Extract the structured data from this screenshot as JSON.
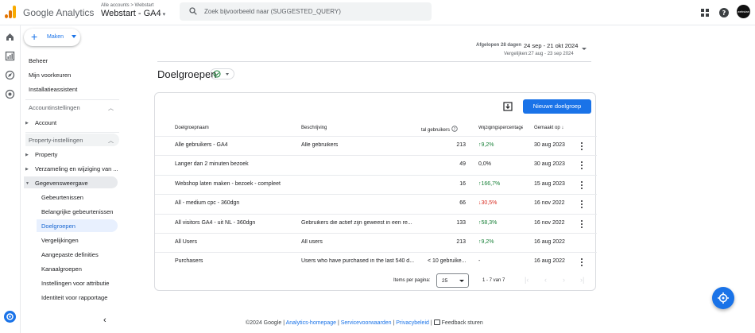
{
  "header": {
    "brand": "Google Analytics",
    "breadcrumb": "Alle accounts > Webstart",
    "property": "Webstart - GA4",
    "search_placeholder": "Zoek bijvoorbeeld naar (SUGGESTED_QUERY)",
    "avatar_text": "webstart"
  },
  "sidebar": {
    "make_label": "Maken",
    "top_items": [
      "Beheer",
      "Mijn voorkeuren",
      "Installatieassistent"
    ],
    "account_section": "Accountinstellingen",
    "account_item": "Account",
    "property_section": "Property-instellingen",
    "property_items": [
      "Property",
      "Verzameling en wijziging van ...",
      "Gegevensweergave"
    ],
    "sub_items": [
      "Gebeurtenissen",
      "Belangrijke gebeurtenissen",
      "Doelgroepen",
      "Vergelijkingen",
      "Aangepaste definities",
      "Kanaalgroepen",
      "Instellingen voor attributie",
      "Identiteit voor rapportage"
    ]
  },
  "date": {
    "label": "Afgelopen 28 dagen",
    "range": "24 sep - 21 okt 2024",
    "compare": "Vergelijken:27 aug - 23 sep 2024"
  },
  "page": {
    "title": "Doelgroepen",
    "new_button": "Nieuwe doelgroep"
  },
  "table": {
    "headers": {
      "name": "Doelgroepnaam",
      "description": "Beschrijving",
      "users": "tal gebruikers",
      "change": "Wijzigingspercentage",
      "created": "Gemaakt op"
    },
    "rows": [
      {
        "name": "Alle gebruikers - GA4",
        "description": "Alle gebruikers",
        "users": "213",
        "change": "9,2%",
        "trend": "up",
        "created": "30 aug 2023",
        "menu": true
      },
      {
        "name": "Langer dan 2 minuten bezoek",
        "description": "",
        "users": "49",
        "change": "0,0%",
        "trend": "neutral",
        "created": "30 aug 2023",
        "menu": true
      },
      {
        "name": "Webshop laten maken - bezoek - compleet",
        "description": "",
        "users": "16",
        "change": "166,7%",
        "trend": "up",
        "created": "15 aug 2023",
        "menu": true
      },
      {
        "name": "All - medium cpc - 360dgn",
        "description": "",
        "users": "66",
        "change": "30,5%",
        "trend": "down",
        "created": "16 nov 2022",
        "menu": true
      },
      {
        "name": "All visitors GA4 - uit NL - 360dgn",
        "description": "Gebruikers die actief zijn geweest in een re...",
        "users": "133",
        "change": "58,3%",
        "trend": "up",
        "created": "16 nov 2022",
        "menu": true
      },
      {
        "name": "All Users",
        "description": "All users",
        "users": "213",
        "change": "9,2%",
        "trend": "up",
        "created": "16 aug 2022",
        "menu": false
      },
      {
        "name": "Purchasers",
        "description": "Users who have purchased in the last 540 d...",
        "users": "< 10 gebruike...",
        "change": "-",
        "trend": "none",
        "created": "16 aug 2022",
        "menu": true
      }
    ]
  },
  "pagination": {
    "label": "Items per pagina:",
    "per_page": "25",
    "range": "1 - 7 van 7"
  },
  "footer": {
    "copyright": "©2024 Google",
    "links": [
      "Analytics-homepage",
      "Servicevoorwaarden",
      "Privacybeleid"
    ],
    "feedback": "Feedback sturen"
  },
  "colors": {
    "accent": "#1a73e8",
    "up": "#188038",
    "down": "#d93025"
  }
}
